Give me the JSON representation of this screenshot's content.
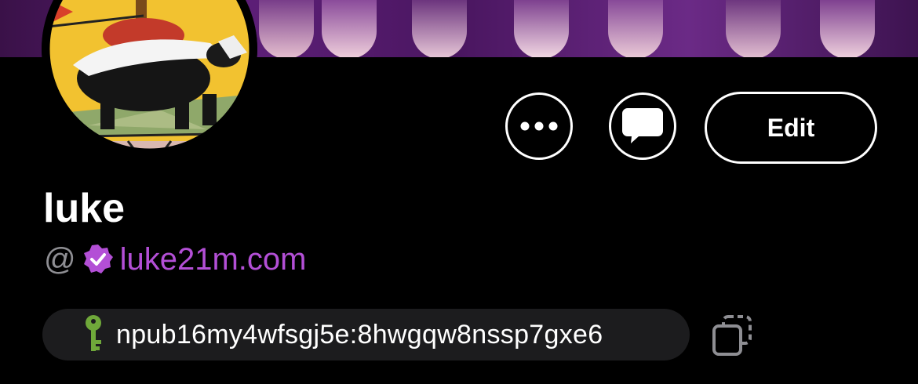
{
  "profile": {
    "name": "luke",
    "at_symbol": "@",
    "nip05_domain": "luke21m.com",
    "npub": "npub16my4wfsgj5e:8hwgqw8nssp7gxe6"
  },
  "actions": {
    "more_icon": "ellipsis-icon",
    "message_icon": "chat-bubble-icon",
    "edit_label": "Edit",
    "copy_icon": "copy-icon"
  },
  "colors": {
    "accent": "#b34fd6",
    "verified_badge": "#b34fd6",
    "key_icon": "#6fa83a",
    "pill_bg": "#1c1c1e",
    "muted": "#8e8e93"
  }
}
